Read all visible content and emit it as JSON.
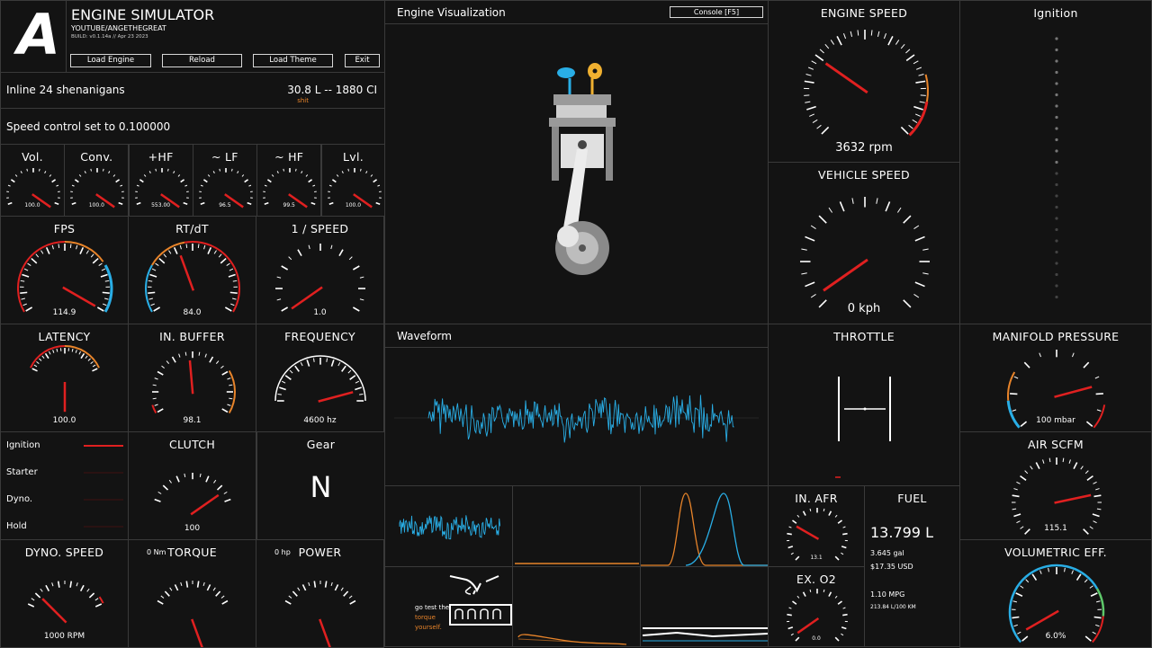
{
  "header": {
    "logo_letter": "A",
    "app_title": "ENGINE SIMULATOR",
    "author": "YOUTUBE/ANGETHEGREAT",
    "build": "BUILD: v0.1.14a // Apr 23 2023",
    "buttons": {
      "load_engine": "Load Engine",
      "reload": "Reload",
      "load_theme": "Load Theme",
      "exit": "Exit"
    }
  },
  "engine_info": {
    "name": "Inline 24 shenanigans",
    "displacement": "30.8 L -- 1880 CI",
    "sub": "shit"
  },
  "status": {
    "message": "Speed control set to 0.100000"
  },
  "mini_gauges": [
    {
      "label": "Vol.",
      "value": "100.0"
    },
    {
      "label": "Conv.",
      "value": "100.0"
    },
    {
      "label": "+HF",
      "value": "553.00"
    },
    {
      "label": "~ LF",
      "value": "96.5"
    },
    {
      "label": "~ HF",
      "value": "99.5"
    },
    {
      "label": "Lvl.",
      "value": "100.0"
    }
  ],
  "gauges": {
    "fps": {
      "label": "FPS",
      "value": "114.9"
    },
    "rtdt": {
      "label": "RT/dT",
      "value": "84.0"
    },
    "speed_inv": {
      "label": "1 / SPEED",
      "value": "1.0"
    },
    "latency": {
      "label": "LATENCY",
      "value": "100.0"
    },
    "in_buffer": {
      "label": "IN. BUFFER",
      "value": "98.1"
    },
    "frequency": {
      "label": "FREQUENCY",
      "value": "4600 hz"
    },
    "clutch": {
      "label": "CLUTCH",
      "value": "100"
    },
    "dyno_speed": {
      "label": "DYNO. SPEED",
      "value": "1000 RPM"
    },
    "torque": {
      "label": "TORQUE",
      "unit": "0 Nm"
    },
    "power": {
      "label": "POWER",
      "unit": "0 hp"
    },
    "engine_speed": {
      "label": "ENGINE SPEED",
      "value": "3632 rpm"
    },
    "vehicle_speed": {
      "label": "VEHICLE SPEED",
      "value": "0 kph"
    },
    "manifold_pressure": {
      "label": "MANIFOLD PRESSURE",
      "value": "100 mbar"
    },
    "air_scfm": {
      "label": "AIR SCFM",
      "value": "115.1"
    },
    "volumetric_eff": {
      "label": "VOLUMETRIC EFF.",
      "value": "6.0%"
    },
    "in_afr": {
      "label": "IN. AFR",
      "value": "13.1"
    },
    "ex_o2": {
      "label": "EX. O2",
      "value": "0.0"
    }
  },
  "gear": {
    "label": "Gear",
    "value": "N"
  },
  "indicators": {
    "ignition": "Ignition",
    "starter": "Starter",
    "dyno": "Dyno.",
    "hold": "Hold"
  },
  "visualization": {
    "title": "Engine Visualization",
    "console_button": "Console [F5]"
  },
  "waveform": {
    "title": "Waveform"
  },
  "throttle": {
    "title": "THROTTLE"
  },
  "ignition_panel": {
    "title": "Ignition"
  },
  "fuel": {
    "title": "FUEL",
    "liters": "13.799 L",
    "gallons": "3.645 gal",
    "cost": "$17.35 USD",
    "mpg": "1.10 MPG",
    "l100km": "213.84 L/100 KM"
  },
  "torque_promo": {
    "line1": "go test the",
    "line2": "torque",
    "line3": "yourself."
  },
  "colors": {
    "accent_red": "#e02020",
    "accent_blue": "#29aee6",
    "accent_orange": "#e8842a",
    "accent_green": "#5ec86a",
    "background": "#111111"
  }
}
